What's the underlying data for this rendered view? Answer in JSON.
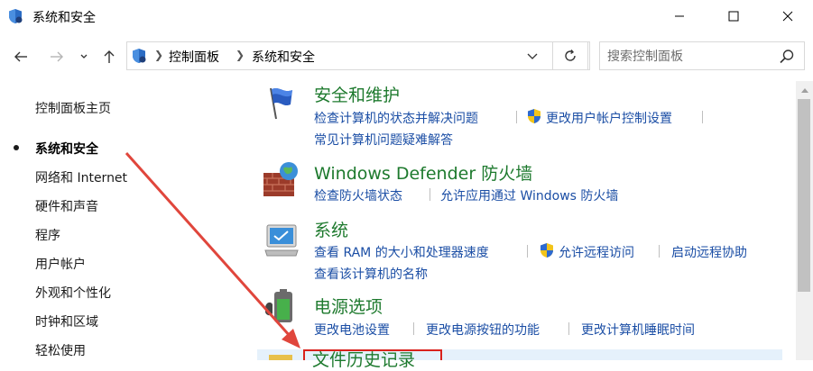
{
  "window": {
    "title": "系统和安全"
  },
  "address": {
    "crumbs": [
      "控制面板",
      "系统和安全"
    ]
  },
  "search": {
    "placeholder": "搜索控制面板"
  },
  "sidebar": {
    "items": [
      {
        "label": "控制面板主页"
      },
      {
        "label": "系统和安全"
      },
      {
        "label": "网络和 Internet"
      },
      {
        "label": "硬件和声音"
      },
      {
        "label": "程序"
      },
      {
        "label": "用户帐户"
      },
      {
        "label": "外观和个性化"
      },
      {
        "label": "时钟和区域"
      },
      {
        "label": "轻松使用"
      }
    ]
  },
  "categories": [
    {
      "title": "安全和维护",
      "links": [
        "检查计算机的状态并解决问题",
        "更改用户帐户控制设置",
        "常见计算机问题疑难解答"
      ]
    },
    {
      "title": "Windows Defender 防火墙",
      "links": [
        "检查防火墙状态",
        "允许应用通过 Windows 防火墙"
      ]
    },
    {
      "title": "系统",
      "links": [
        "查看 RAM 的大小和处理器速度",
        "允许远程访问",
        "启动远程协助",
        "查看该计算机的名称"
      ]
    },
    {
      "title": "电源选项",
      "links": [
        "更改电池设置",
        "更改电源按钮的功能",
        "更改计算机睡眠时间"
      ]
    },
    {
      "title": "文件历史记录",
      "links": []
    }
  ],
  "colors": {
    "category_title": "#1e7a2e",
    "link": "#1b4ea5",
    "annotation": "#e0463c"
  },
  "icons": {
    "titlebar": "control-panel-shield-icon",
    "minimize": "minimize-icon",
    "maximize": "maximize-icon",
    "close": "close-icon",
    "back": "back-arrow-icon",
    "forward": "forward-arrow-icon",
    "recent": "chevron-down-icon",
    "up": "up-arrow-icon",
    "refresh": "refresh-icon",
    "search": "search-icon",
    "uac_shield": "uac-shield-icon"
  }
}
